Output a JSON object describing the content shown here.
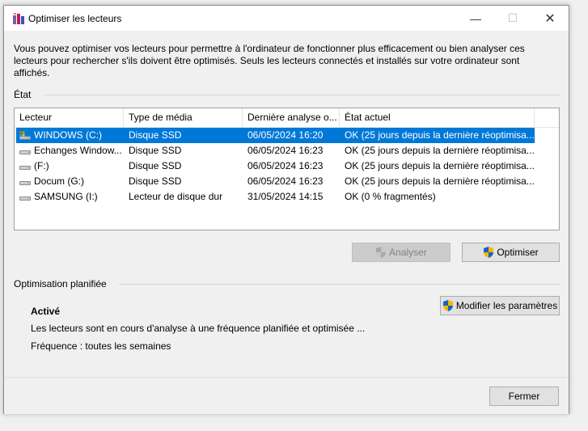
{
  "window": {
    "title": "Optimiser les lecteurs",
    "minimize_symbol": "—",
    "maximize_symbol": "☐",
    "close_symbol": "✕"
  },
  "description": "Vous pouvez optimiser vos lecteurs pour permettre à l'ordinateur de fonctionner plus efficacement ou bien analyser ces lecteurs pour rechercher s'ils doivent être optimisés. Seuls les lecteurs connectés et installés sur votre ordinateur sont affichés.",
  "status_group": {
    "label": "État"
  },
  "drives_table": {
    "columns": [
      "Lecteur",
      "Type de média",
      "Dernière analyse o...",
      "État actuel"
    ],
    "rows": [
      {
        "drive": "WINDOWS (C:)",
        "media": "Disque SSD",
        "last": "06/05/2024 16:20",
        "status": "OK (25 jours depuis la dernière réoptimisa...",
        "icon": "system-drive-icon",
        "selected": true
      },
      {
        "drive": "Echanges Window...",
        "media": "Disque SSD",
        "last": "06/05/2024 16:23",
        "status": "OK (25 jours depuis la dernière réoptimisa...",
        "icon": "drive-icon",
        "selected": false
      },
      {
        "drive": "(F:)",
        "media": "Disque SSD",
        "last": "06/05/2024 16:23",
        "status": "OK (25 jours depuis la dernière réoptimisa...",
        "icon": "drive-icon",
        "selected": false
      },
      {
        "drive": "Docum (G:)",
        "media": "Disque SSD",
        "last": "06/05/2024 16:23",
        "status": "OK (25 jours depuis la dernière réoptimisa...",
        "icon": "drive-icon",
        "selected": false
      },
      {
        "drive": "SAMSUNG (I:)",
        "media": "Lecteur de disque dur",
        "last": "31/05/2024 14:15",
        "status": "OK (0 % fragmentés)",
        "icon": "drive-icon",
        "selected": false
      }
    ]
  },
  "actions": {
    "analyze_label": "Analyser",
    "optimize_label": "Optimiser"
  },
  "scheduled": {
    "label": "Optimisation planifiée",
    "status": "Activé",
    "description": "Les lecteurs sont en cours d'analyse à une fréquence planifiée et optimisée ...",
    "frequency": "Fréquence : toutes les semaines",
    "modify_label": "Modifier les paramètres"
  },
  "footer": {
    "close_label": "Fermer"
  },
  "colors": {
    "selection": "#0078d7",
    "window_bg": "#f0f0f0",
    "button_bg": "#e1e1e1"
  }
}
